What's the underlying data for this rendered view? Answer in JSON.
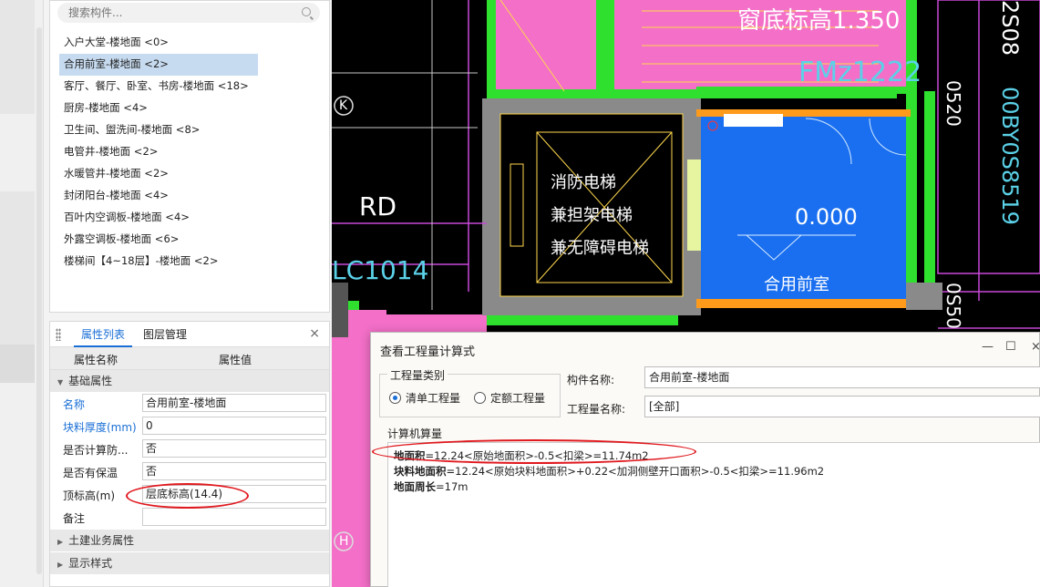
{
  "search": {
    "placeholder": "搜索构件..."
  },
  "components": [
    "入户大堂-楼地面 <0>",
    "合用前室-楼地面 <2>",
    "客厅、餐厅、卧室、书房-楼地面 <18>",
    "厨房-楼地面 <4>",
    "卫生间、盥洗间-楼地面 <8>",
    "电管井-楼地面 <2>",
    "水暖管井-楼地面 <2>",
    "封闭阳台-楼地面 <4>",
    "百叶内空调板-楼地面 <4>",
    "外露空调板-楼地面 <6>",
    "楼梯间【4~18层】-楼地面 <2>"
  ],
  "prop_panel": {
    "tab_properties": "属性列表",
    "tab_layers": "图层管理",
    "close": "×",
    "col_name": "属性名称",
    "col_value": "属性值",
    "group_basic": "基础属性",
    "rows": [
      {
        "name": "名称",
        "value": "合用前室-楼地面"
      },
      {
        "name": "块料厚度(mm)",
        "value": "0"
      },
      {
        "name": "是否计算防...",
        "value": "否"
      },
      {
        "name": "是否有保温",
        "value": "否"
      },
      {
        "name": "顶标高(m)",
        "value": "层底标高(14.4)"
      },
      {
        "name": "备注",
        "value": ""
      }
    ],
    "group_civil": "土建业务属性",
    "group_display": "显示样式"
  },
  "cad": {
    "window_sill": "窗底标高1.350",
    "door_tag": "FMz1222",
    "grid_k": "K",
    "grid_h": "H",
    "rd": "RD",
    "lc": "LC1014",
    "elev_text_1": "消防电梯",
    "elev_text_2": "兼担架电梯",
    "elev_text_3": "兼无障碍电梯",
    "level": "0.000",
    "room": "合用前室",
    "right_1": "2S08",
    "right_2": "00BY0S8519",
    "right_3": "0520",
    "right_4": "0S50"
  },
  "dialog": {
    "title": "查看工程量计算式",
    "minimize": "—",
    "maximize": "☐",
    "close": "×",
    "qty_type_legend": "工程量类别",
    "radio_list": "清单工程量",
    "radio_quota": "定额工程量",
    "comp_name_label": "构件名称:",
    "comp_name_value": "合用前室-楼地面",
    "qty_name_label": "工程量名称:",
    "qty_name_value": "[全部]",
    "computer_legend": "计算机算量",
    "f1_name": "地面积",
    "f1_expr": "=12.24<原始地面积>-0.5<扣梁>=11.74m2",
    "f2_name": "块料地面积",
    "f2_expr": "=12.24<原始块料地面积>+0.22<加洞侧壁开口面积>-0.5<扣梁>=11.96m2",
    "f3_name": "地面周长",
    "f3_expr": "=17m"
  },
  "colors": {
    "annotation_red": "#e0191f",
    "accent_blue": "#1a6fd6",
    "cad_pink": "#f36fc8",
    "cad_green": "#2fe02f",
    "cad_blue": "#1a6ff0"
  }
}
